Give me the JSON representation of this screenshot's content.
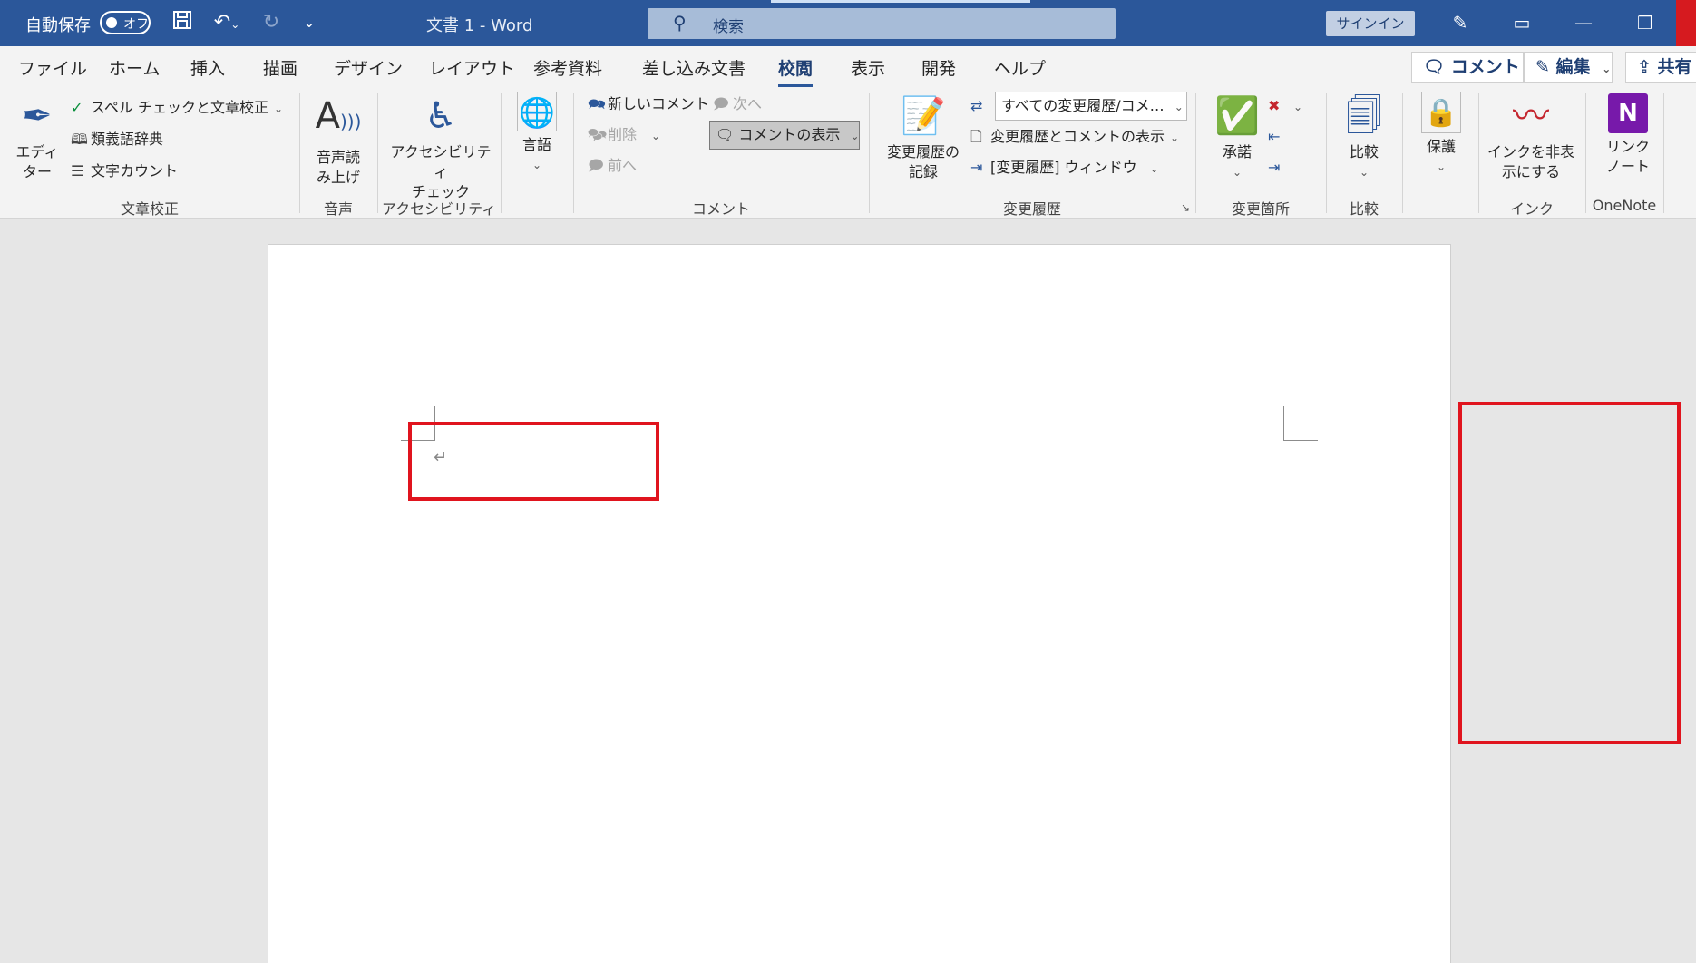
{
  "titlebar": {
    "autosave_label": "自動保存",
    "autosave_state": "オフ",
    "document_title": "文書 1  -  Word",
    "search_placeholder": "検索",
    "signin_label": "サインイン",
    "icons": [
      "save-icon",
      "undo-icon",
      "redo-icon",
      "customize-quick-access-icon",
      "pen-icon",
      "ribbon-display-icon",
      "minimize-icon",
      "restore-icon"
    ]
  },
  "tabs": {
    "items": [
      "ファイル",
      "ホーム",
      "挿入",
      "描画",
      "デザイン",
      "レイアウト",
      "参考資料",
      "差し込み文書",
      "校閲",
      "表示",
      "開発",
      "ヘルプ"
    ],
    "active": "校閲",
    "comment_button": "コメント",
    "edit_button": "編集",
    "share_button": "共有"
  },
  "ribbon": {
    "proofing": {
      "group_label": "文章校正",
      "editor_label": "エディ\nター",
      "spelling_label": "スペル チェックと文章校正",
      "thesaurus_label": "類義語辞典",
      "wordcount_label": "文字カウント"
    },
    "speech": {
      "group_label": "音声",
      "read_aloud_label": "音声読\nみ上げ"
    },
    "accessibility": {
      "group_label": "アクセシビリティ",
      "check_label": "アクセシビリティ\nチェック"
    },
    "language": {
      "label": "言語"
    },
    "comments": {
      "group_label": "コメント",
      "new_label": "新しいコメント",
      "delete_label": "削除",
      "prev_label": "前へ",
      "next_label": "次へ",
      "show_label": "コメントの表示"
    },
    "tracking": {
      "group_label": "変更履歴",
      "track_label": "変更履歴の\n記録",
      "markup_select": "すべての変更履歴/コメ…",
      "show_markup_label": "変更履歴とコメントの表示",
      "pane_label": "[変更履歴] ウィンドウ"
    },
    "changes": {
      "group_label": "変更箇所",
      "accept_label": "承諾"
    },
    "compare": {
      "group_label": "比較",
      "compare_label": "比較"
    },
    "protect": {
      "protect_label": "保護"
    },
    "ink": {
      "group_label": "インク",
      "hide_ink_label": "インクを非表\n示にする"
    },
    "onenote": {
      "group_label": "OneNote",
      "linked_notes_label": "リンク\nノート"
    }
  },
  "document": {
    "paragraph_mark": "↵"
  },
  "colors": {
    "titlebar": "#2b579a",
    "highlight": "#e0141e",
    "ribbon_bg": "#f3f3f3",
    "canvas_bg": "#e6e6e6"
  }
}
